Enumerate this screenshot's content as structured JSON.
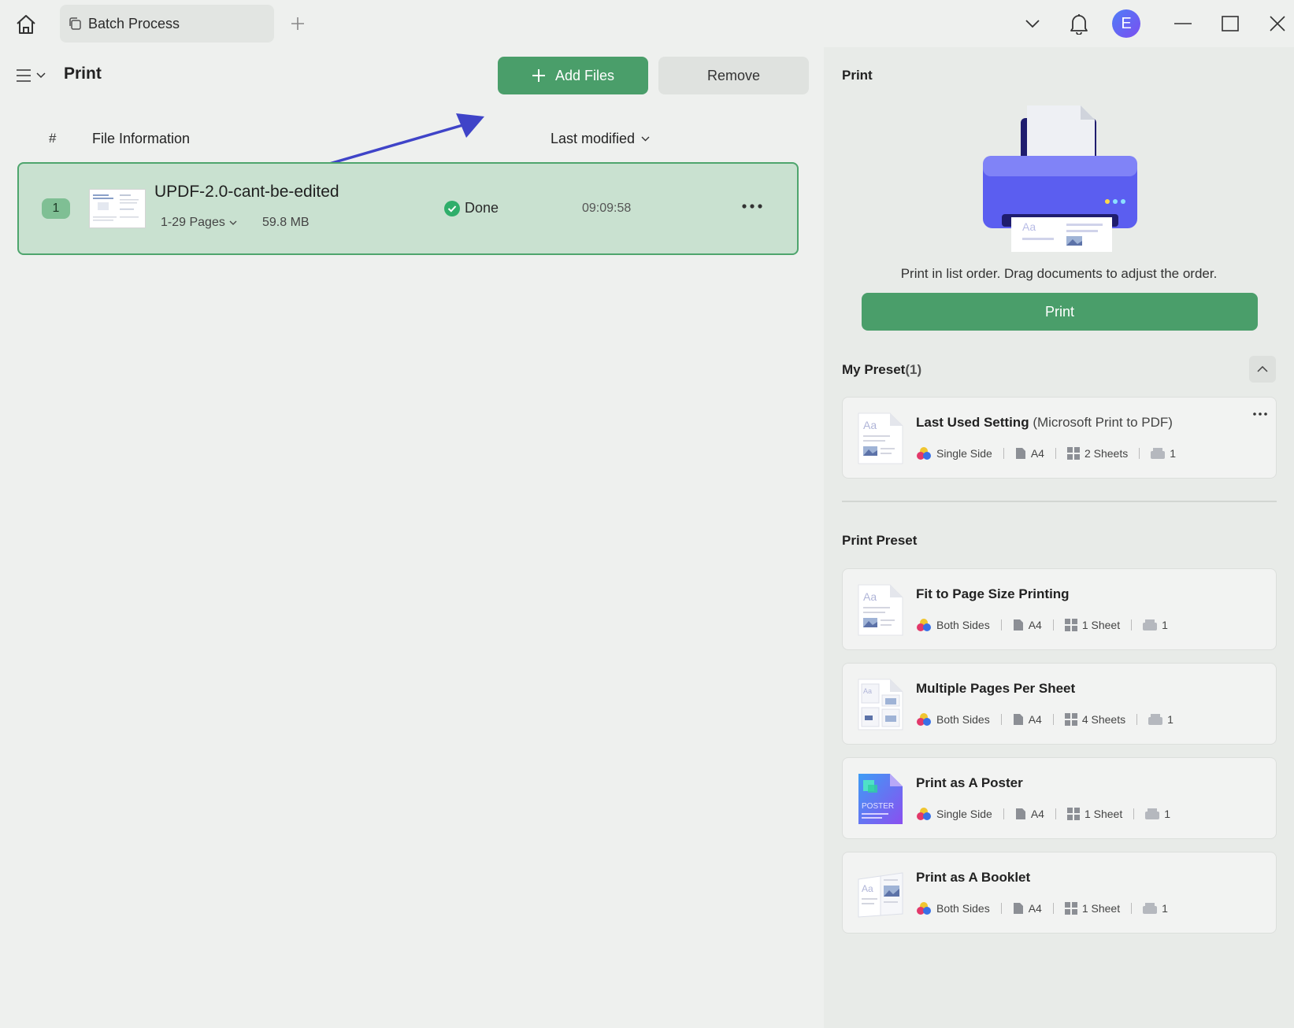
{
  "titlebar": {
    "tab_label": "Batch Process",
    "avatar_letter": "E"
  },
  "left": {
    "title": "Print",
    "add_files_label": "Add Files",
    "remove_label": "Remove",
    "columns": {
      "index": "#",
      "file_info": "File Information",
      "last_modified": "Last modified"
    },
    "files": [
      {
        "index": "1",
        "name": "UPDF-2.0-cant-be-edited",
        "pages": "1-29 Pages",
        "size": "59.8 MB",
        "status": "Done",
        "time": "09:09:58"
      }
    ]
  },
  "right": {
    "title": "Print",
    "hint": "Print in list order. Drag documents to adjust the order.",
    "print_button": "Print",
    "my_preset": {
      "title": "My Preset",
      "count": "(1)",
      "items": [
        {
          "name": "Last Used Setting",
          "printer": "(Microsoft Print to PDF)",
          "sides": "Single Side",
          "paper": "A4",
          "sheets": "2 Sheets",
          "copies": "1"
        }
      ]
    },
    "print_preset": {
      "title": "Print Preset",
      "items": [
        {
          "name": "Fit to Page Size Printing",
          "sides": "Both Sides",
          "paper": "A4",
          "sheets": "1 Sheet",
          "copies": "1",
          "icon": "page-icon"
        },
        {
          "name": "Multiple Pages Per Sheet",
          "sides": "Both Sides",
          "paper": "A4",
          "sheets": "4 Sheets",
          "copies": "1",
          "icon": "multi-page-icon"
        },
        {
          "name": "Print as A Poster",
          "sides": "Single Side",
          "paper": "A4",
          "sheets": "1 Sheet",
          "copies": "1",
          "icon": "poster-icon",
          "icon_label": "POSTER"
        },
        {
          "name": "Print as A Booklet",
          "sides": "Both Sides",
          "paper": "A4",
          "sheets": "1 Sheet",
          "copies": "1",
          "icon": "booklet-icon"
        }
      ]
    }
  },
  "colors": {
    "accent_green": "#4a9e6a",
    "row_selected_bg": "#c9e1d0",
    "arrow_blue": "#3f44c8",
    "printer_purple": "#5b5ef0"
  }
}
